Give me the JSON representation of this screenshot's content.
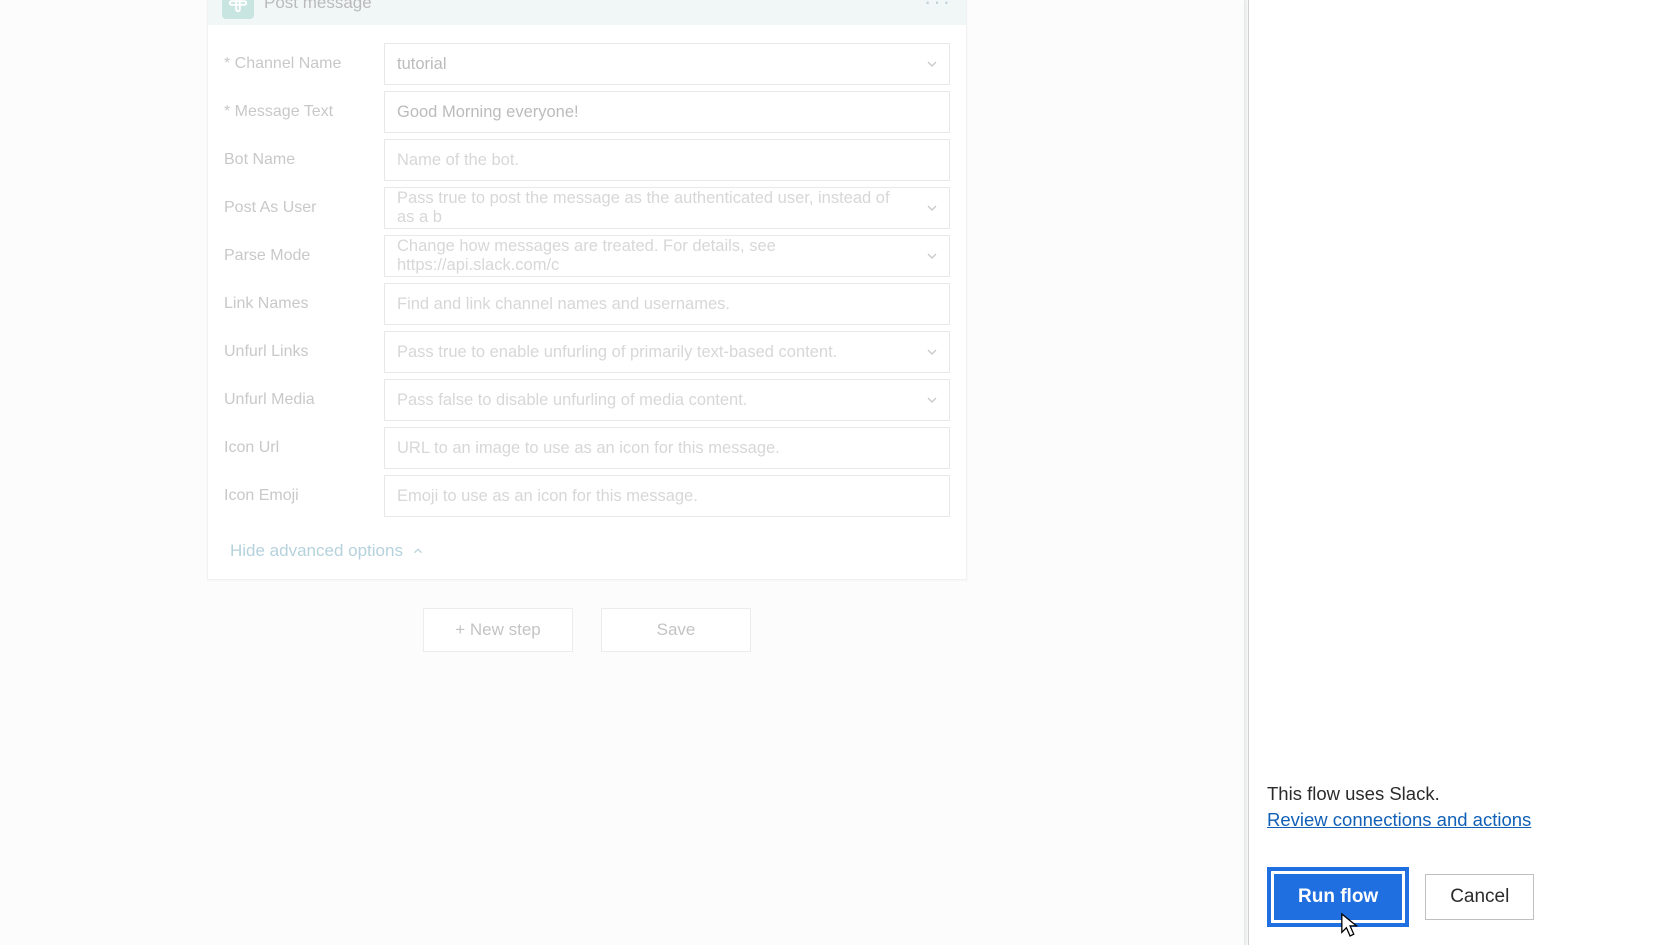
{
  "card": {
    "title": "Post message",
    "menu_icon": "···",
    "fields": {
      "channel_name": {
        "label": "* Channel Name",
        "value": "tutorial",
        "has_chevron": true,
        "placeholder": ""
      },
      "message_text": {
        "label": "* Message Text",
        "value": "Good Morning everyone!",
        "has_chevron": false,
        "placeholder": ""
      },
      "bot_name": {
        "label": "Bot Name",
        "value": "",
        "has_chevron": false,
        "placeholder": "Name of the bot."
      },
      "post_as_user": {
        "label": "Post As User",
        "value": "",
        "has_chevron": true,
        "placeholder": "Pass true to post the message as the authenticated user, instead of as a b"
      },
      "parse_mode": {
        "label": "Parse Mode",
        "value": "",
        "has_chevron": true,
        "placeholder": "Change how messages are treated. For details, see https://api.slack.com/c"
      },
      "link_names": {
        "label": "Link Names",
        "value": "",
        "has_chevron": false,
        "placeholder": "Find and link channel names and usernames."
      },
      "unfurl_links": {
        "label": "Unfurl Links",
        "value": "",
        "has_chevron": true,
        "placeholder": "Pass true to enable unfurling of primarily text-based content."
      },
      "unfurl_media": {
        "label": "Unfurl Media",
        "value": "",
        "has_chevron": true,
        "placeholder": "Pass false to disable unfurling of media content."
      },
      "icon_url": {
        "label": "Icon Url",
        "value": "",
        "has_chevron": false,
        "placeholder": "URL to an image to use as an icon for this message."
      },
      "icon_emoji": {
        "label": "Icon Emoji",
        "value": "",
        "has_chevron": false,
        "placeholder": "Emoji to use as an icon for this message."
      }
    },
    "hide_advanced": "Hide advanced options"
  },
  "footer": {
    "new_step": "+  New step",
    "save": "Save"
  },
  "panel": {
    "uses_text": "This flow uses Slack.",
    "review_link": "Review connections and actions",
    "run_flow": "Run flow",
    "cancel": "Cancel"
  }
}
